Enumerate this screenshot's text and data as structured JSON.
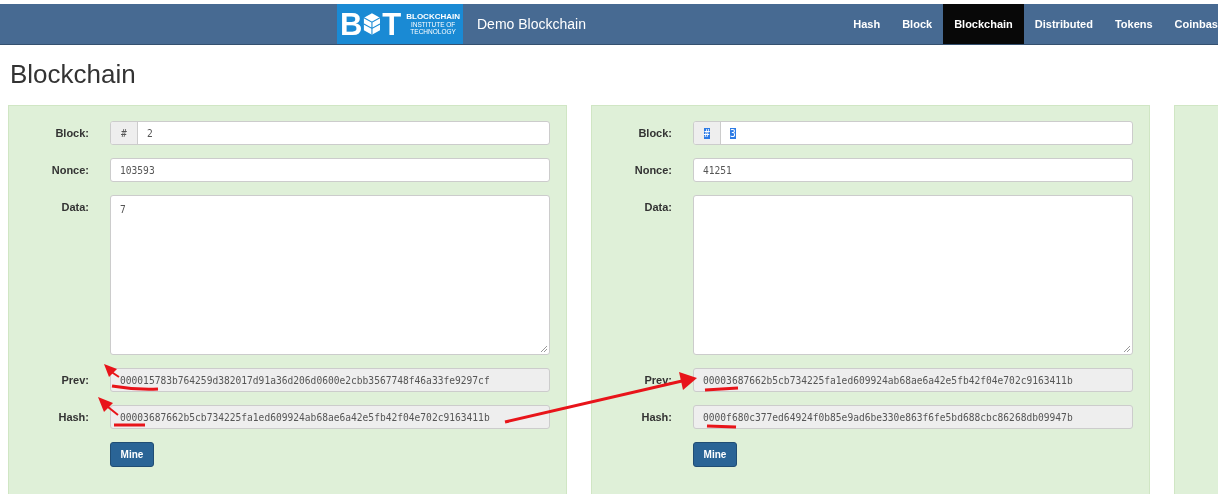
{
  "navbar": {
    "logo": {
      "letter_left": "B",
      "letter_right": "T",
      "lines": [
        "BLOCKCHAIN",
        "INSTITUTE OF",
        "TECHNOLOGY"
      ]
    },
    "brand": "Demo Blockchain",
    "items": [
      {
        "label": "Hash",
        "selected": false
      },
      {
        "label": "Block",
        "selected": false
      },
      {
        "label": "Blockchain",
        "selected": true
      },
      {
        "label": "Distributed",
        "selected": false
      },
      {
        "label": "Tokens",
        "selected": false
      },
      {
        "label": "Coinbas",
        "selected": false
      }
    ]
  },
  "title": "Blockchain",
  "cards": [
    {
      "block_label": "Block:",
      "block_prefix": "#",
      "block": "2",
      "highlighted": false,
      "nonce_label": "Nonce:",
      "nonce": "103593",
      "data_label": "Data:",
      "data": "7",
      "prev_label": "Prev:",
      "prev": "000015783b764259d382017d91a36d206d0600e2cbb3567748f46a33fe9297cf",
      "hash_label": "Hash:",
      "hash": "00003687662b5cb734225fa1ed609924ab68ae6a42e5fb42f04e702c9163411b",
      "button": "Mine"
    },
    {
      "block_label": "Block:",
      "block_prefix": "#",
      "block": "3",
      "highlighted": true,
      "nonce_label": "Nonce:",
      "nonce": "41251",
      "data_label": "Data:",
      "prev_label": "Prev:",
      "prev": "00003687662b5cb734225fa1ed609924ab68ae6a42e5fb42f04e702c9163411b",
      "hash_label": "Hash:",
      "hash": "0000f680c377ed64924f0b85e9ad6be330e863f6fe5bd688cbc86268db09947b",
      "button": "Mine"
    }
  ]
}
